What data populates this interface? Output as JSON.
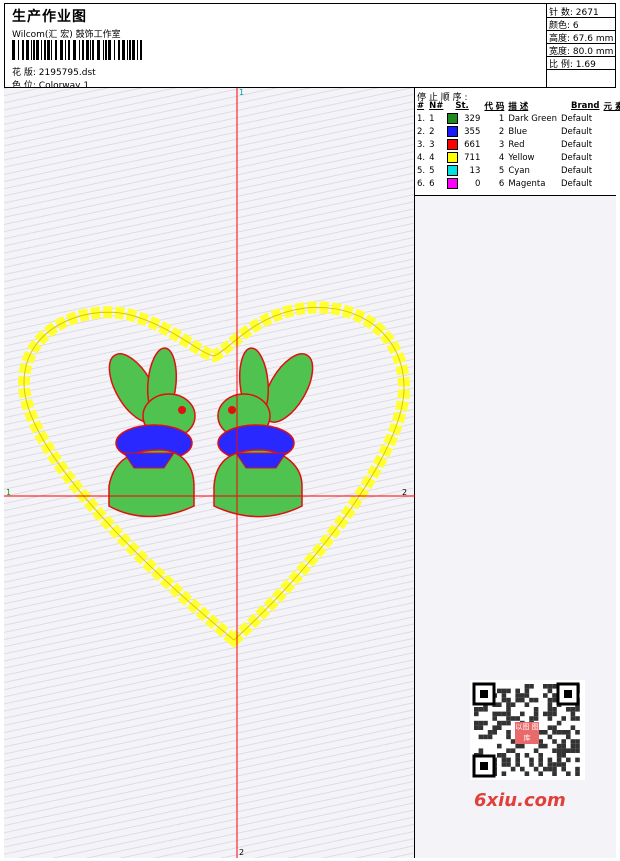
{
  "header": {
    "title": "生产作业图",
    "subtitle": "Wilcom(汇 宏) 鼓饰工作室",
    "design_label": "花 版:",
    "design_value": "2195795.dst",
    "colorway_label": "色 位:",
    "colorway_value": "Colorway 1"
  },
  "stats": [
    {
      "label": "针 数:",
      "value": "2671"
    },
    {
      "label": "颜色:",
      "value": "6"
    },
    {
      "label": "高度:",
      "value": "67.6 mm"
    },
    {
      "label": "宽度:",
      "value": "80.0 mm"
    },
    {
      "label": "比 例:",
      "value": "1.69"
    }
  ],
  "stop_sequence": {
    "title": "停 止 顺 序 :",
    "columns": [
      "#",
      "N#",
      "St.",
      "代 码",
      "描 述",
      "Brand",
      "元 素"
    ],
    "rows": [
      {
        "idx": "1.",
        "n": "1",
        "st": "329",
        "code": "1",
        "desc": "Dark Green",
        "brand": "Default",
        "color": "#1e8a1e"
      },
      {
        "idx": "2.",
        "n": "2",
        "st": "355",
        "code": "2",
        "desc": "Blue",
        "brand": "Default",
        "color": "#1a1aff"
      },
      {
        "idx": "3.",
        "n": "3",
        "st": "661",
        "code": "3",
        "desc": "Red",
        "brand": "Default",
        "color": "#ff0000"
      },
      {
        "idx": "4.",
        "n": "4",
        "st": "711",
        "code": "4",
        "desc": "Yellow",
        "brand": "Default",
        "color": "#ffff00"
      },
      {
        "idx": "5.",
        "n": "5",
        "st": "13",
        "code": "5",
        "desc": "Cyan",
        "brand": "Default",
        "color": "#00e0e0"
      },
      {
        "idx": "6.",
        "n": "6",
        "st": "0",
        "code": "6",
        "desc": "Magenta",
        "brand": "Default",
        "color": "#ff00ff"
      }
    ]
  },
  "axes": {
    "top": "1",
    "bottom": "2",
    "left": "1",
    "right": "2"
  },
  "colors": {
    "axis": "#ff0000",
    "heart": "#ffff33",
    "green": "#2ea52e",
    "blue": "#2828ff",
    "red": "#e01010"
  },
  "watermark": {
    "text": "6xiu.com",
    "stamp": "以图 图库"
  }
}
